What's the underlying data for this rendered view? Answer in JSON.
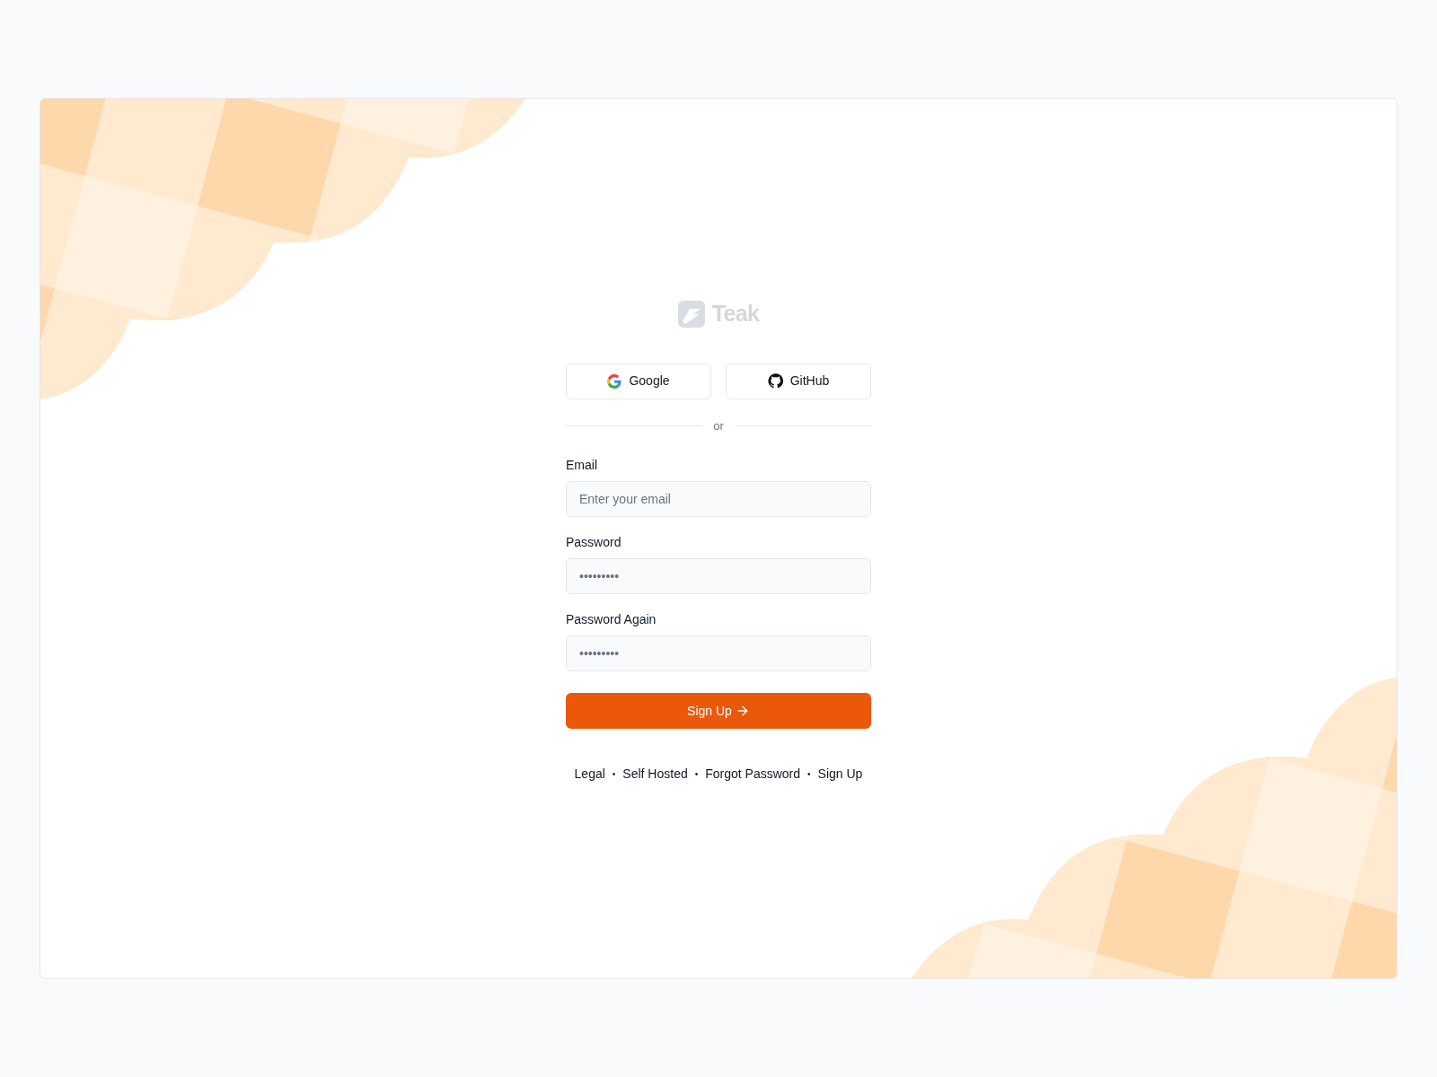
{
  "logo": {
    "text": "Teak"
  },
  "oauth_buttons": [
    {
      "kind": "google",
      "label": "Google"
    },
    {
      "kind": "github",
      "label": "GitHub"
    }
  ],
  "divider": "or",
  "fields": [
    {
      "label": "Email",
      "placeholder": "Enter your email"
    },
    {
      "label": "Password",
      "placeholder": "•••••••••"
    },
    {
      "label": "Password Again",
      "placeholder": "•••••••••"
    }
  ],
  "submit": {
    "label": "Sign Up"
  },
  "footer_links": [
    "Legal",
    "Self Hosted",
    "Forgot Password",
    "Sign Up"
  ],
  "footer_separator": "•"
}
